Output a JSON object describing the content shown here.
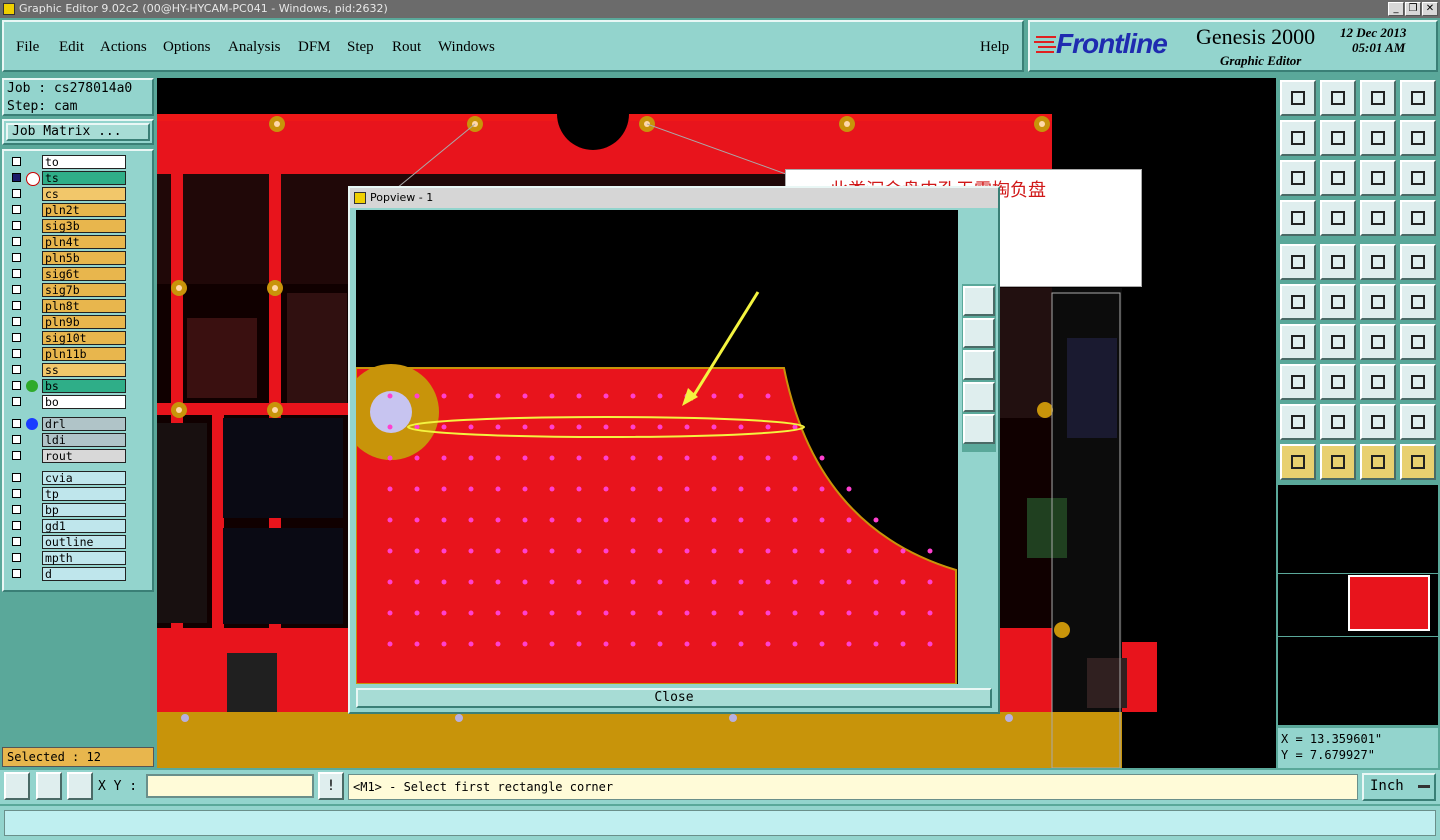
{
  "window": {
    "title": "Graphic Editor 9.02c2 (00@HY-HYCAM-PC041 - Windows, pid:2632)",
    "controls": [
      "_",
      "❐",
      "✕"
    ]
  },
  "menu": [
    "File",
    "Edit",
    "Actions",
    "Options",
    "Analysis",
    "DFM",
    "Step",
    "Rout",
    "Windows"
  ],
  "help": "Help",
  "brand": {
    "logo": "Frontline",
    "product": "Genesis 2000",
    "module": "Graphic Editor",
    "date": "12 Dec 2013",
    "time": "05:01 AM"
  },
  "job": {
    "job_label": "Job : cs278014a0",
    "step_label": "Step: cam",
    "matrix_button": "Job Matrix ..."
  },
  "layers_group1": [
    {
      "name": "to",
      "color": "#ffffff",
      "mark": "pen"
    },
    {
      "name": "ts",
      "color": "#2fae88",
      "mark": "grid",
      "active": true
    },
    {
      "name": "cs",
      "color": "#f2c76a"
    },
    {
      "name": "pln2t",
      "color": "#e8b64d"
    },
    {
      "name": "sig3b",
      "color": "#e8b64d"
    },
    {
      "name": "pln4t",
      "color": "#e8b64d"
    },
    {
      "name": "pln5b",
      "color": "#e8b64d"
    },
    {
      "name": "sig6t",
      "color": "#e8b64d"
    },
    {
      "name": "sig7b",
      "color": "#e8b64d"
    },
    {
      "name": "pln8t",
      "color": "#e8b64d"
    },
    {
      "name": "pln9b",
      "color": "#e8b64d"
    },
    {
      "name": "sig10t",
      "color": "#e8b64d"
    },
    {
      "name": "pln11b",
      "color": "#e8b64d"
    },
    {
      "name": "ss",
      "color": "#f2c76a"
    },
    {
      "name": "bs",
      "color": "#2fae88",
      "dot": "#2faa2a"
    },
    {
      "name": "bo",
      "color": "#ffffff",
      "mark": "pen"
    }
  ],
  "layers_group2": [
    {
      "name": "drl",
      "color": "#b0c4c8",
      "dot": "#1a3cff"
    },
    {
      "name": "ldi",
      "color": "#b0c4c8"
    },
    {
      "name": "rout",
      "color": "#d8d8d8"
    }
  ],
  "layers_group3": [
    {
      "name": "cvia",
      "color": "#bfe6ec"
    },
    {
      "name": "tp",
      "color": "#bfe6ec"
    },
    {
      "name": "bp",
      "color": "#bfe6ec"
    },
    {
      "name": "gd1",
      "color": "#bfe6ec",
      "mark": "pen"
    },
    {
      "name": "outline",
      "color": "#bfe6ec",
      "mark": "pen"
    },
    {
      "name": "mpth",
      "color": "#bfe6ec"
    },
    {
      "name": "d",
      "color": "#bfe6ec"
    }
  ],
  "selected": "Selected : 12",
  "popview": {
    "title": "Popview - 1",
    "close": "Close"
  },
  "annotation": "此类沉金盘中孔无需掏负盘",
  "coords": {
    "x": "X = 13.359601\"",
    "y": "Y = 7.679927\""
  },
  "xy_label": "X Y :",
  "xy_value": "",
  "status": "<M1> - Select first rectangle corner",
  "units": "Inch",
  "icons": {
    "toolbox": [
      "home-icon",
      "zoom-in-icon",
      "snap-icon",
      "ruler-icon",
      "select-icon",
      "measure-icon"
    ]
  }
}
